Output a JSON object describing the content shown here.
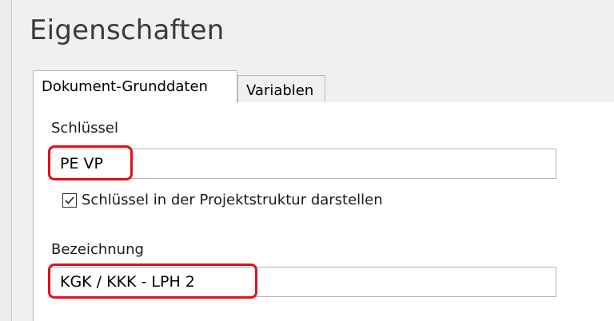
{
  "window": {
    "title": "Eigenschaften"
  },
  "tabs": [
    {
      "label": "Dokument-Grunddaten",
      "active": true
    },
    {
      "label": "Variablen",
      "active": false
    }
  ],
  "form": {
    "key_label": "Schlüssel",
    "key_value": "PE VP",
    "show_in_structure_label": "Schlüssel in der Projektstruktur darstellen",
    "show_in_structure_checked": true,
    "name_label": "Bezeichnung",
    "name_value": "KGK / KKK - LPH 2"
  },
  "colors": {
    "highlight": "#e0101a",
    "panel_bg": "#ffffff",
    "dialog_bg": "#f0f0f0"
  }
}
